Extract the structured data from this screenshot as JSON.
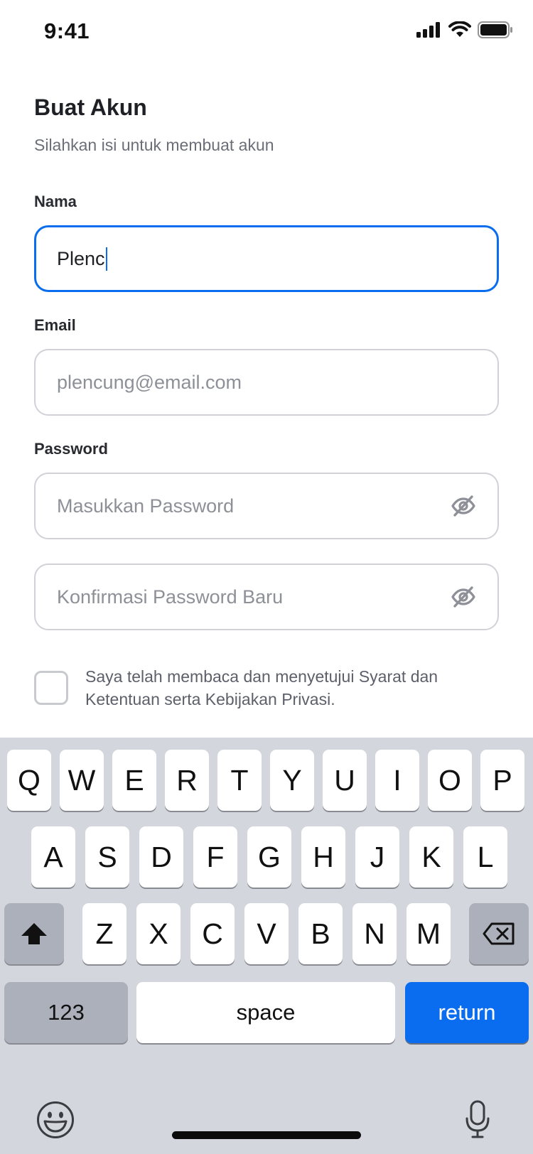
{
  "status_bar": {
    "time": "9:41"
  },
  "form": {
    "title": "Buat Akun",
    "subtitle": "Silahkan isi untuk membuat akun",
    "name_label": "Nama",
    "name_value": "Plenc",
    "email_label": "Email",
    "email_placeholder": "plencung@email.com",
    "password_label": "Password",
    "password_placeholder": "Masukkan Password",
    "confirm_placeholder": "Konfirmasi Password Baru",
    "consent_line1": "Saya telah membaca dan menyetujui Syarat dan",
    "consent_line2": "Ketentuan serta Kebijakan Privasi.",
    "consent_checked": false
  },
  "keyboard": {
    "row1": [
      "Q",
      "W",
      "E",
      "R",
      "T",
      "Y",
      "U",
      "I",
      "O",
      "P"
    ],
    "row2": [
      "A",
      "S",
      "D",
      "F",
      "G",
      "H",
      "J",
      "K",
      "L"
    ],
    "row3": [
      "Z",
      "X",
      "C",
      "V",
      "B",
      "N",
      "M"
    ],
    "numbers_label": "123",
    "space_label": "space",
    "return_label": "return"
  },
  "colors": {
    "accent": "#0a6df0",
    "keyboard_bg": "#d3d6dd"
  },
  "icons": [
    "signal-icon",
    "wifi-icon",
    "battery-icon",
    "eye-off-icon",
    "shift-icon",
    "backspace-icon",
    "emoji-icon",
    "microphone-icon"
  ]
}
